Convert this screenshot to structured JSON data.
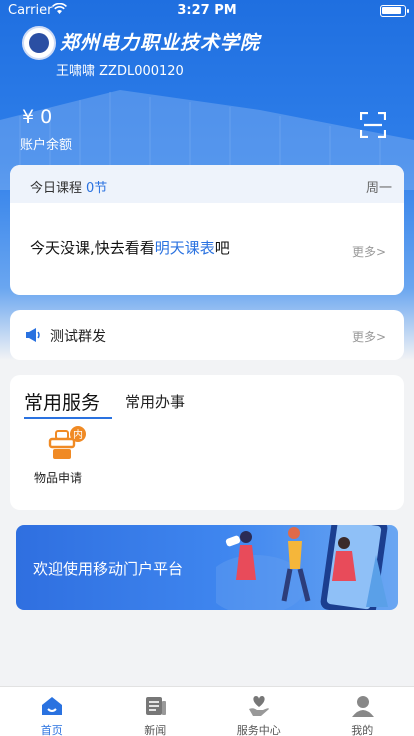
{
  "status_bar": {
    "carrier": "Carrier",
    "time": "3:27 PM"
  },
  "header": {
    "school_name": "郑州电力职业技术学院",
    "user_line": "王啸啸 ZZDL000120",
    "balance_amount": "¥ 0",
    "balance_label": "账户余额"
  },
  "course": {
    "title": "今日课程",
    "count": "0节",
    "weekday": "周一",
    "message_prefix": "今天没课,快去看看",
    "message_link": "明天课表",
    "message_suffix": "吧",
    "more": "更多>"
  },
  "notice": {
    "text": "测试群发",
    "more": "更多>"
  },
  "services": {
    "tab_active": "常用服务",
    "tab_other": "常用办事",
    "items": [
      {
        "label": "物品申请",
        "icon": "goods-request-icon",
        "badge": "内"
      }
    ]
  },
  "banner": {
    "text": "欢迎使用移动门户平台"
  },
  "tabbar": [
    {
      "label": "首页",
      "icon": "home-icon",
      "active": true
    },
    {
      "label": "新闻",
      "icon": "news-icon",
      "active": false
    },
    {
      "label": "服务中心",
      "icon": "service-center-icon",
      "active": false
    },
    {
      "label": "我的",
      "icon": "profile-icon",
      "active": false
    }
  ],
  "colors": {
    "accent": "#2a72e0",
    "hero": "#1f6fe0",
    "background": "#f2f3f5"
  }
}
